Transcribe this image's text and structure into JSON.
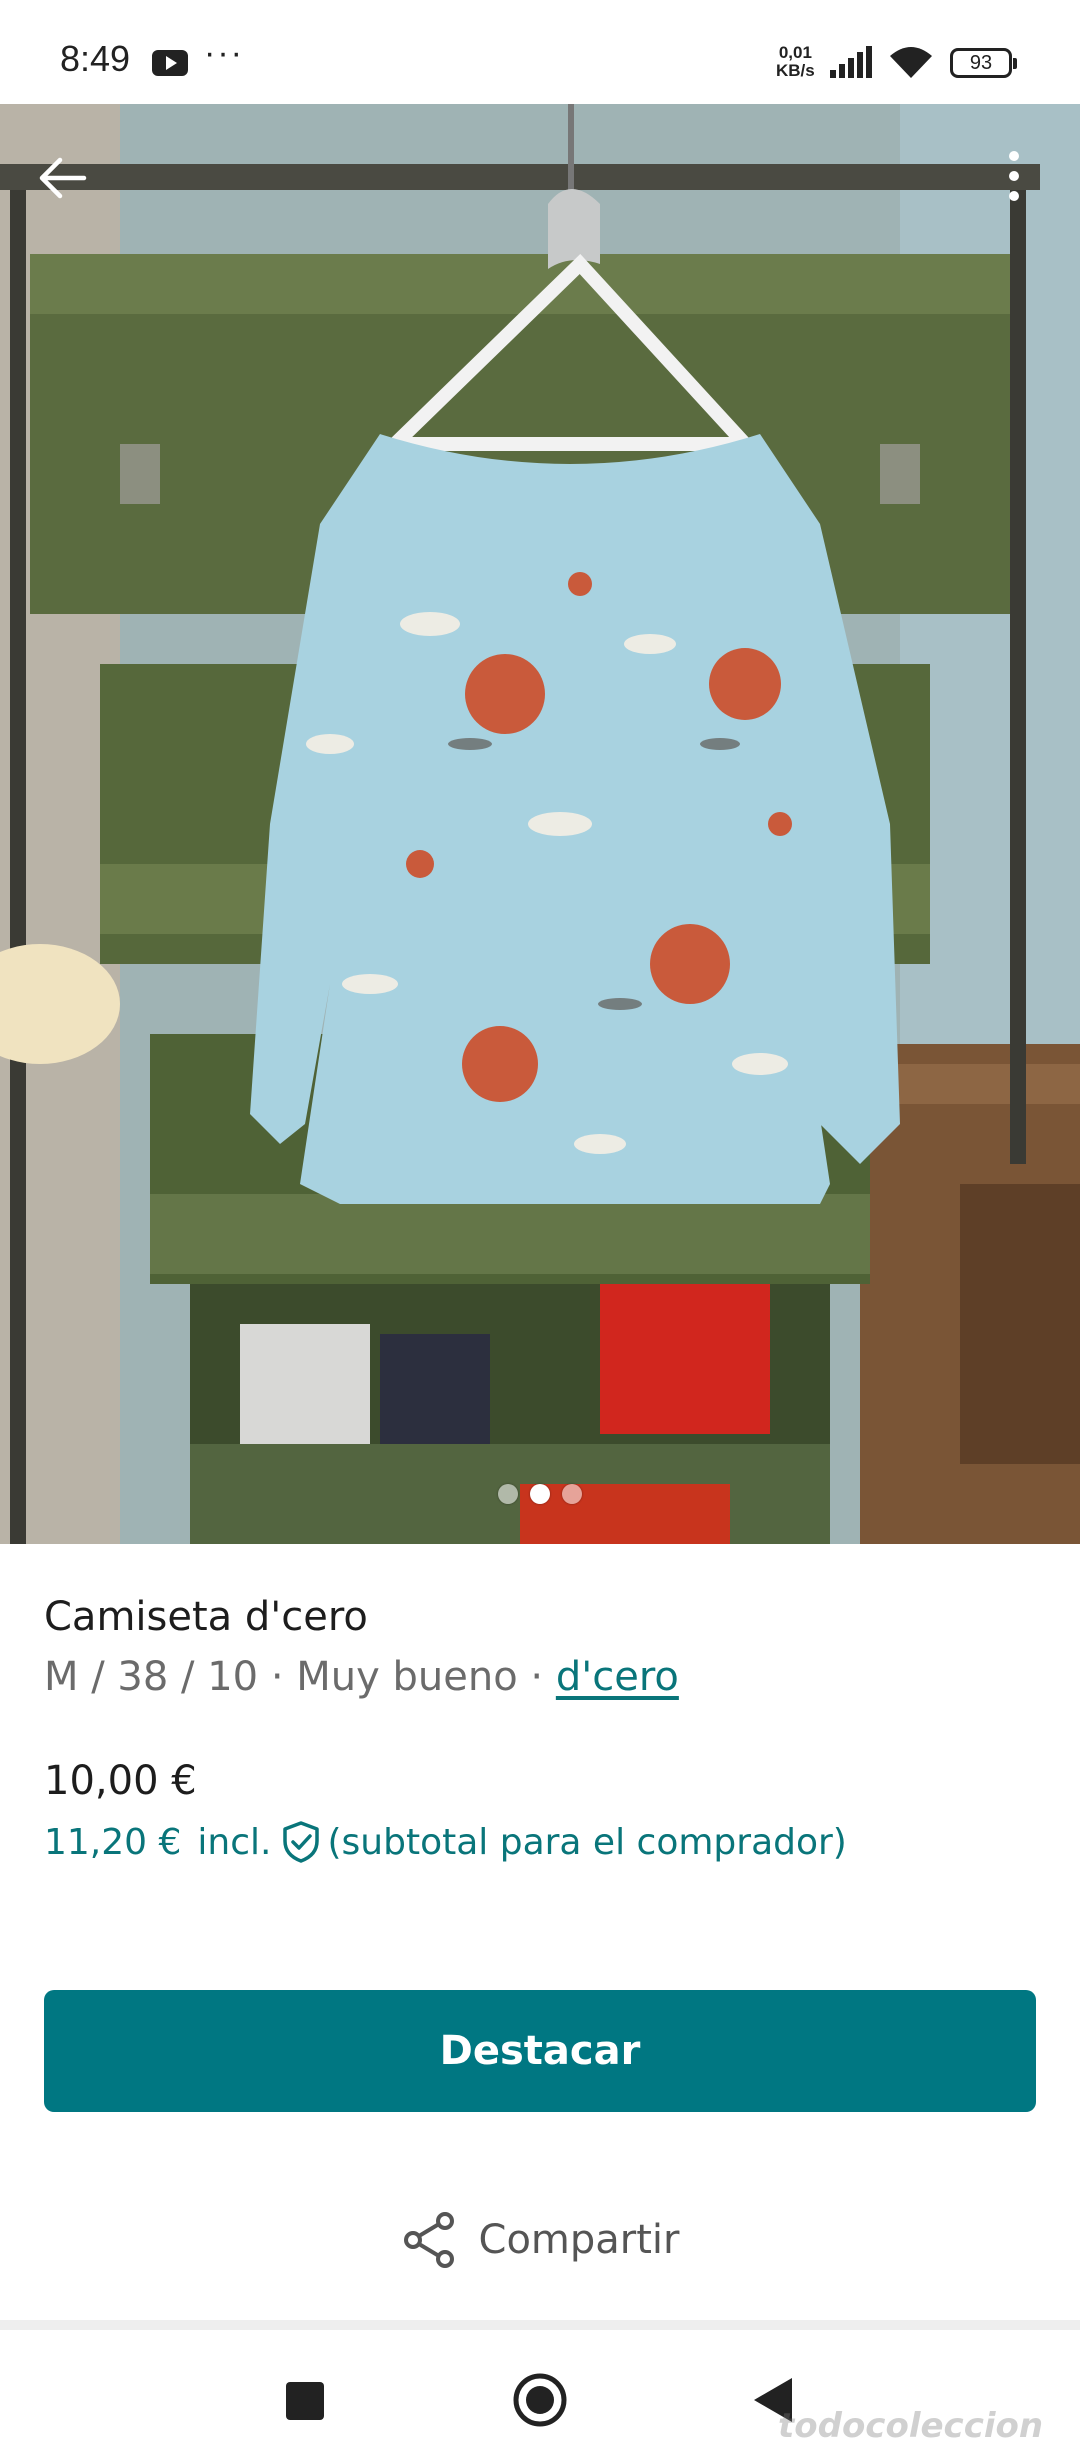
{
  "status_bar": {
    "time": "8:49",
    "net_speed_value": "0,01",
    "net_speed_unit": "KB/s",
    "battery": "93",
    "more_indicator": "···"
  },
  "photo": {
    "description_icons": [
      "back-arrow-icon",
      "more-vert-icon"
    ],
    "pager": {
      "count": 3,
      "active": 1
    }
  },
  "item": {
    "title": "Camiseta d'cero",
    "meta_prefix": "M / 38 / 10 · Muy bueno · ",
    "brand": "d'cero",
    "price": "10,00 €",
    "buyer_price": "11,20 €",
    "buyer_incl": "incl.",
    "buyer_note": "(subtotal para el comprador)"
  },
  "actions": {
    "primary_label": "Destacar",
    "share_label": "Compartir"
  },
  "watermark": "todocoleccion",
  "colors": {
    "accent": "#007782",
    "link": "#09757a"
  }
}
